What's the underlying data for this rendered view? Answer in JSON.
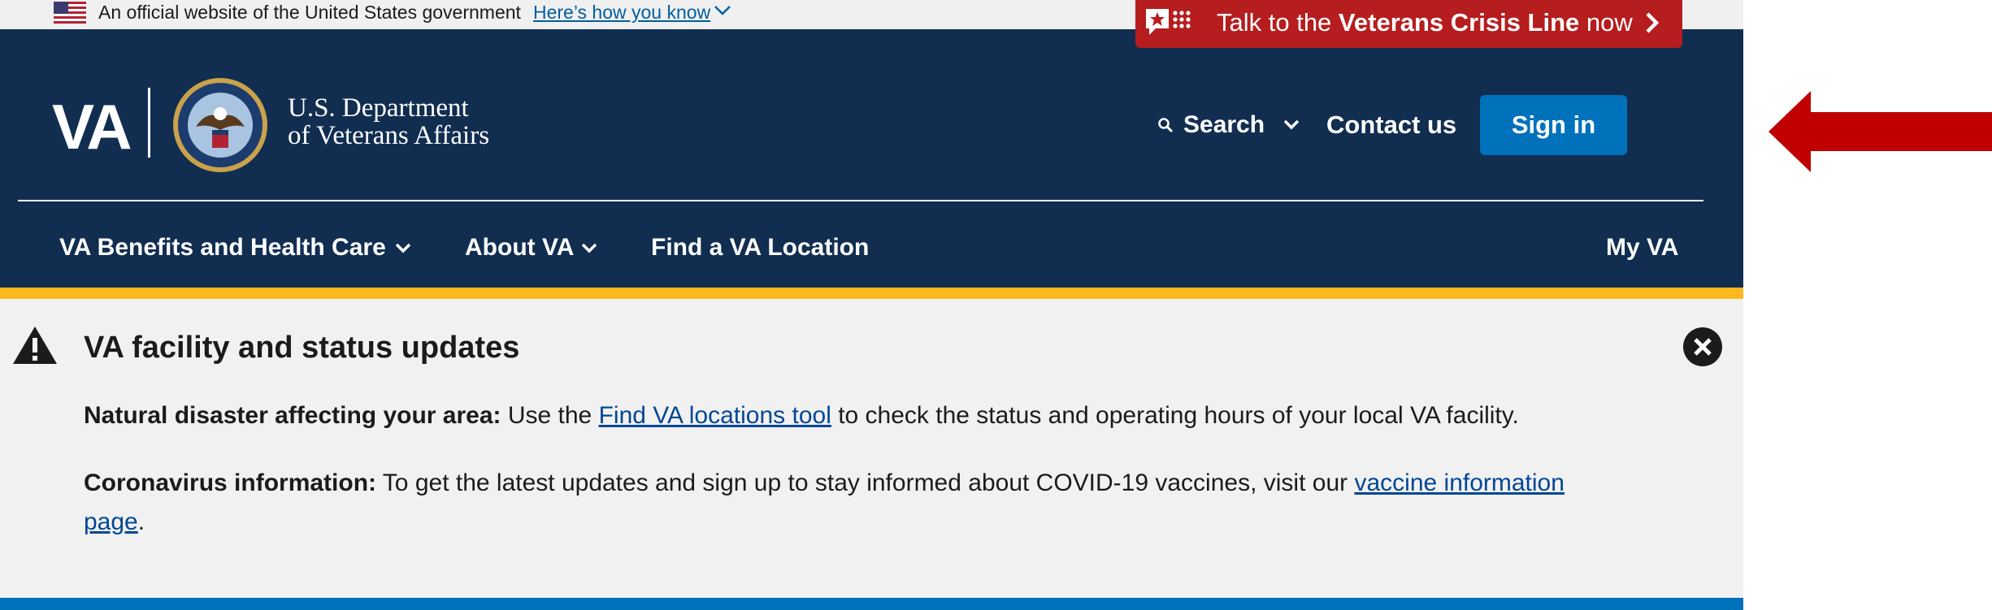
{
  "gov_banner": {
    "text": "An official website of the United States government",
    "link": "Here’s how you know"
  },
  "crisis_line": {
    "prefix": "Talk to the ",
    "bold": "Veterans Crisis Line",
    "suffix": " now"
  },
  "logo": {
    "mark": "VA",
    "dept_line1": "U.S. Department",
    "dept_line2": "of Veterans Affairs"
  },
  "header": {
    "search_label": "Search",
    "contact_label": "Contact us",
    "signin_label": "Sign in"
  },
  "nav": {
    "items": [
      {
        "label": "VA Benefits and Health Care"
      },
      {
        "label": "About VA"
      },
      {
        "label": "Find a VA Location"
      },
      {
        "label": "My VA"
      }
    ]
  },
  "alert": {
    "title": "VA facility and status updates",
    "p1_bold": "Natural disaster affecting your area:",
    "p1_pre": " Use the ",
    "p1_link": "Find VA locations tool",
    "p1_post": " to check the status and operating hours of your local VA facility.",
    "p2_bold": "Coronavirus information:",
    "p2_pre": " To get the latest updates and sign up to stay informed about COVID-19 vaccines, visit our ",
    "p2_link": "vaccine information page",
    "p2_post": "."
  },
  "colors": {
    "header_bg": "#112e51",
    "crisis_bg": "#b51d1e",
    "gold": "#fdb81e",
    "signin_bg": "#0071bb",
    "alert_bg": "#f1f1f1",
    "arrow": "#c00000"
  }
}
